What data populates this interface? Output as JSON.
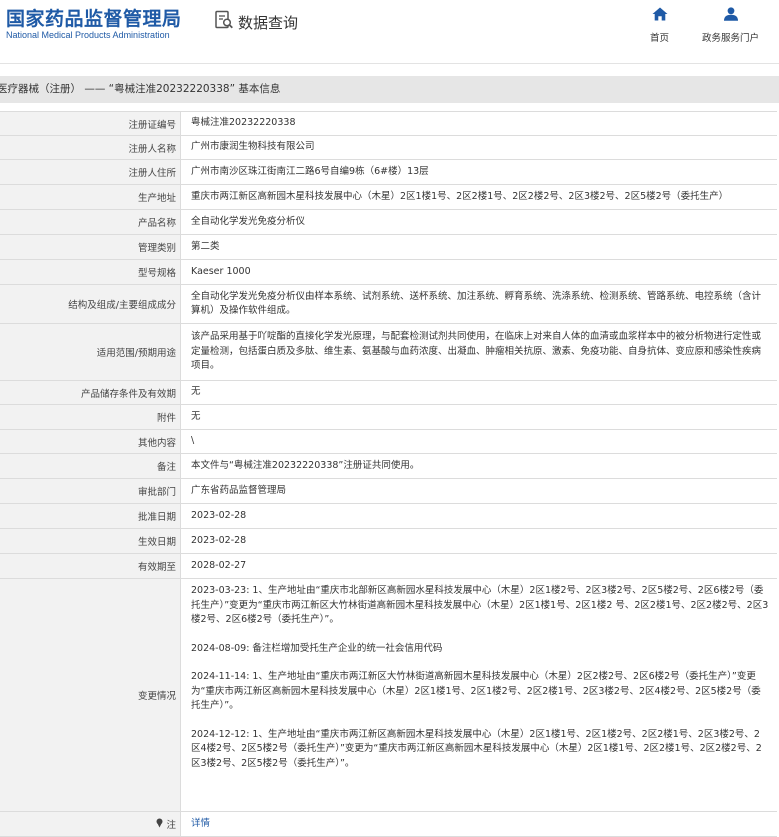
{
  "header": {
    "logo_cn": "国家药品监督管理局",
    "logo_en": "National Medical Products Administration",
    "search_label": "数据查询",
    "nav_home": "首页",
    "nav_portal": "政务服务门户"
  },
  "title": "医疗器械（注册） —— “粤械注准20232220338” 基本信息",
  "rows": {
    "reg_no": {
      "label": "注册证编号",
      "value": "粤械注准20232220338"
    },
    "registrant": {
      "label": "注册人名称",
      "value": "广州市康润生物科技有限公司"
    },
    "address": {
      "label": "注册人住所",
      "value": "广州市南沙区珠江街南江二路6号自编9栋（6#楼）13层"
    },
    "prod_addr": {
      "label": "生产地址",
      "value": "重庆市两江新区高新园木星科技发展中心（木星）2区1楼1号、2区2楼1号、2区2楼2号、2区3楼2号、2区5楼2号（委托生产）"
    },
    "product": {
      "label": "产品名称",
      "value": "全自动化学发光免疫分析仪"
    },
    "category": {
      "label": "管理类别",
      "value": "第二类"
    },
    "model": {
      "label": "型号规格",
      "value": "Kaeser 1000"
    },
    "structure": {
      "label": "结构及组成/主要组成成分",
      "value": "全自动化学发光免疫分析仪由样本系统、试剂系统、送杯系统、加注系统、孵育系统、洗涤系统、检测系统、管路系统、电控系统（含计算机）及操作软件组成。"
    },
    "scope": {
      "label": "适用范围/预期用途",
      "value": "该产品采用基于吖啶酯的直接化学发光原理，与配套检测试剂共同使用，在临床上对来自人体的血清或血浆样本中的被分析物进行定性或定量检测，包括蛋白质及多肽、维生素、氨基酸与血药浓度、出凝血、肿瘤相关抗原、激素、免疫功能、自身抗体、变应原和感染性疾病项目。"
    },
    "storage": {
      "label": "产品储存条件及有效期",
      "value": "无"
    },
    "attachment": {
      "label": "附件",
      "value": "无"
    },
    "other": {
      "label": "其他内容",
      "value": "\\"
    },
    "remark": {
      "label": "备注",
      "value": "本文件与“粤械注准20232220338”注册证共同使用。"
    },
    "dept": {
      "label": "审批部门",
      "value": "广东省药品监督管理局"
    },
    "approve_date": {
      "label": "批准日期",
      "value": "2023-02-28"
    },
    "effective_date": {
      "label": "生效日期",
      "value": "2023-02-28"
    },
    "expiry": {
      "label": "有效期至",
      "value": "2028-02-27"
    },
    "changes": {
      "label": "变更情况",
      "entries": [
        "2023-03-23: 1、生产地址由“重庆市北部新区高新园水星科技发展中心（木星）2区1楼2号、2区3楼2号、2区5楼2号、2区6楼2号（委托生产）”变更为“重庆市两江新区大竹林街道高新园木星科技发展中心（木星）2区1楼1号、2区1楼2 号、2区2楼1号、2区2楼2号、2区3楼2号、2区6楼2号（委托生产）”。",
        "2024-08-09: 备注栏增加受托生产企业的统一社会信用代码",
        "2024-11-14: 1、生产地址由“重庆市两江新区大竹林街道高新园木星科技发展中心（木星）2区2楼2号、2区6楼2号（委托生产）”变更为“重庆市两江新区高新园木星科技发展中心（木星）2区1楼1号、2区1楼2号、2区2楼1号、2区3楼2号、2区4楼2号、2区5楼2号（委托生产）”。",
        "2024-12-12: 1、生产地址由“重庆市两江新区高新园木星科技发展中心（木星）2区1楼1号、2区1楼2号、2区2楼1号、2区3楼2号、2区4楼2号、2区5楼2号（委托生产）”变更为“重庆市两江新区高新园木星科技发展中心（木星）2区1楼1号、2区2楼1号、2区2楼2号、2区3楼2号、2区5楼2号（委托生产）”。"
      ]
    },
    "note": {
      "label": "注",
      "link": "详情"
    }
  }
}
